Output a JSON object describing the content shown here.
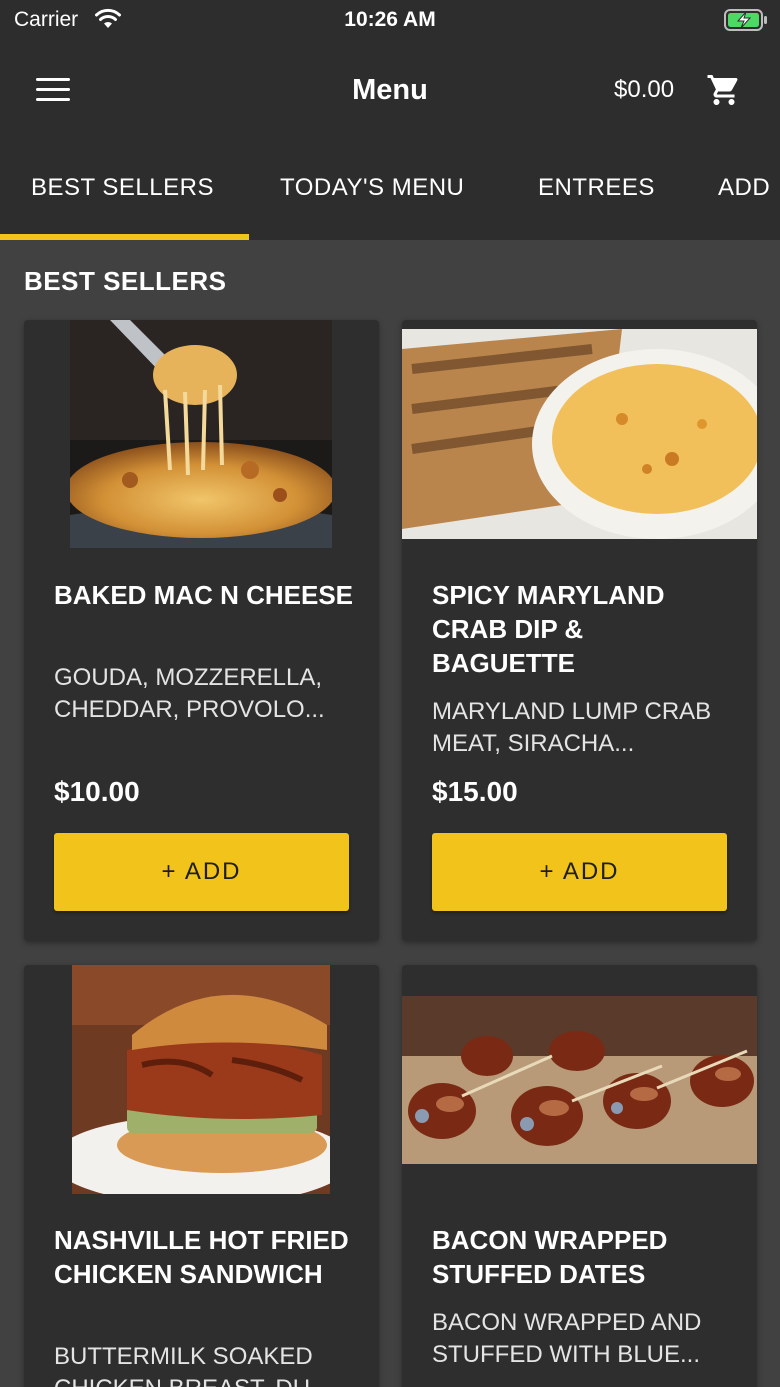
{
  "status": {
    "carrier": "Carrier",
    "time": "10:26 AM"
  },
  "nav": {
    "title": "Menu",
    "cart_total": "$0.00"
  },
  "tabs": [
    {
      "label": "BEST SELLERS",
      "active": true
    },
    {
      "label": "TODAY'S MENU"
    },
    {
      "label": "ENTREES"
    },
    {
      "label": "ADD"
    }
  ],
  "section": {
    "title": "BEST SELLERS"
  },
  "items": [
    {
      "name": "BAKED MAC N CHEESE",
      "description": "GOUDA, MOZZERELLA, CHEDDAR, PROVOLO...",
      "price": "$10.00",
      "add_label": "+  ADD"
    },
    {
      "name": "SPICY MARYLAND CRAB DIP & BAGUETTE",
      "description": "MARYLAND LUMP CRAB MEAT, SIRACHA...",
      "price": "$15.00",
      "add_label": "+  ADD"
    },
    {
      "name": "NASHVILLE HOT FRIED CHICKEN SANDWICH",
      "description": "BUTTERMILK SOAKED CHICKEN BREAST, DU..."
    },
    {
      "name": "BACON WRAPPED STUFFED DATES",
      "description": "BACON WRAPPED AND STUFFED WITH BLUE..."
    }
  ],
  "colors": {
    "accent": "#f2c31a",
    "background": "#414141",
    "bar": "#2d2d2d",
    "card": "#2e2e2e"
  },
  "icons": [
    "wifi-icon",
    "battery-charging-icon",
    "hamburger-menu-icon",
    "cart-icon"
  ]
}
